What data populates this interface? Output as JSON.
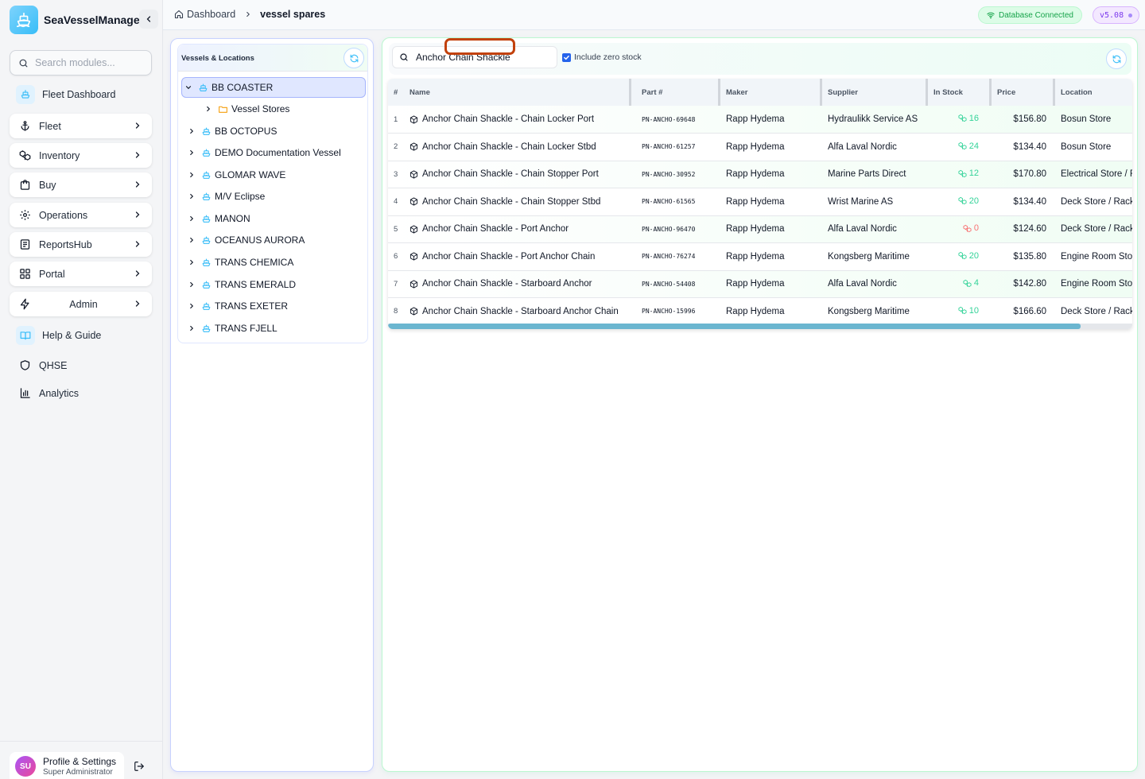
{
  "app": {
    "title": "SeaVesselManager"
  },
  "sidebar": {
    "search_placeholder": "Search modules...",
    "items": [
      {
        "label": "Fleet Dashboard",
        "icon": "ship-icon"
      },
      {
        "label": "Fleet",
        "icon": "anchor-icon"
      },
      {
        "label": "Inventory",
        "icon": "boxes-icon"
      },
      {
        "label": "Buy",
        "icon": "shopping-bag-icon"
      },
      {
        "label": "Operations",
        "icon": "gear-icon"
      },
      {
        "label": "ReportsHub",
        "icon": "report-icon"
      },
      {
        "label": "Portal",
        "icon": "grid-icon"
      },
      {
        "label": "Admin",
        "icon": "lightning-icon"
      },
      {
        "label": "Help & Guide",
        "icon": "book-icon"
      },
      {
        "label": "QHSE",
        "icon": "shield-icon"
      },
      {
        "label": "Analytics",
        "icon": "bar-chart-icon"
      }
    ],
    "profile": {
      "initials": "SU",
      "name": "Profile & Settings",
      "role": "Super Administrator"
    }
  },
  "header": {
    "breadcrumb": [
      "Dashboard",
      "vessel spares"
    ],
    "db_status": "Database Connected",
    "version": "v5.08"
  },
  "vessels": {
    "title": "Vessels & Locations",
    "tree": [
      {
        "label": "BB COASTER",
        "expanded": true,
        "selected": true
      },
      {
        "label": "Vessel Stores",
        "child": true
      },
      {
        "label": "BB OCTOPUS"
      },
      {
        "label": "DEMO Documentation Vessel"
      },
      {
        "label": "GLOMAR WAVE"
      },
      {
        "label": "M/V Eclipse"
      },
      {
        "label": "MANON"
      },
      {
        "label": "OCEANUS AURORA"
      },
      {
        "label": "TRANS CHEMICA"
      },
      {
        "label": "TRANS EMERALD"
      },
      {
        "label": "TRANS EXETER"
      },
      {
        "label": "TRANS FJELL"
      }
    ]
  },
  "spares": {
    "search_value": "Anchor Chain Shackle",
    "include_zero_label": "Include zero stock",
    "include_zero_checked": true,
    "columns": [
      "#",
      "Name",
      "Part #",
      "Maker",
      "Supplier",
      "In Stock",
      "Price",
      "Location"
    ],
    "rows": [
      {
        "n": "1",
        "name": "Anchor Chain Shackle - Chain Locker Port",
        "part": "PN-ANCHO-69648",
        "maker": "Rapp Hydema",
        "supplier": "Hydraulikk Service AS",
        "stock": "16",
        "price": "$156.80",
        "location": "Bosun Store"
      },
      {
        "n": "2",
        "name": "Anchor Chain Shackle - Chain Locker Stbd",
        "part": "PN-ANCHO-61257",
        "maker": "Rapp Hydema",
        "supplier": "Alfa Laval Nordic",
        "stock": "24",
        "price": "$134.40",
        "location": "Bosun Store"
      },
      {
        "n": "3",
        "name": "Anchor Chain Shackle - Chain Stopper Port",
        "part": "PN-ANCHO-30952",
        "maker": "Rapp Hydema",
        "supplier": "Marine Parts Direct",
        "stock": "12",
        "price": "$170.80",
        "location": "Electrical Store / Rack A"
      },
      {
        "n": "4",
        "name": "Anchor Chain Shackle - Chain Stopper Stbd",
        "part": "PN-ANCHO-61565",
        "maker": "Rapp Hydema",
        "supplier": "Wrist Marine AS",
        "stock": "20",
        "price": "$134.40",
        "location": "Deck Store / Rack B"
      },
      {
        "n": "5",
        "name": "Anchor Chain Shackle - Port Anchor",
        "part": "PN-ANCHO-96470",
        "maker": "Rapp Hydema",
        "supplier": "Alfa Laval Nordic",
        "stock": "0",
        "price": "$124.60",
        "location": "Deck Store / Rack A"
      },
      {
        "n": "6",
        "name": "Anchor Chain Shackle - Port Anchor Chain",
        "part": "PN-ANCHO-76274",
        "maker": "Rapp Hydema",
        "supplier": "Kongsberg Maritime",
        "stock": "20",
        "price": "$135.80",
        "location": "Engine Room Store"
      },
      {
        "n": "7",
        "name": "Anchor Chain Shackle - Starboard Anchor",
        "part": "PN-ANCHO-54408",
        "maker": "Rapp Hydema",
        "supplier": "Alfa Laval Nordic",
        "stock": "4",
        "price": "$142.80",
        "location": "Engine Room Store"
      },
      {
        "n": "8",
        "name": "Anchor Chain Shackle - Starboard Anchor Chain",
        "part": "PN-ANCHO-15996",
        "maker": "Rapp Hydema",
        "supplier": "Kongsberg Maritime",
        "stock": "10",
        "price": "$166.60",
        "location": "Deck Store / Rack C"
      }
    ]
  },
  "colors": {
    "in_stock": "#34d399",
    "out_of_stock": "#f87171",
    "accent": "#38bdf8",
    "highlight": "#c2410c"
  }
}
